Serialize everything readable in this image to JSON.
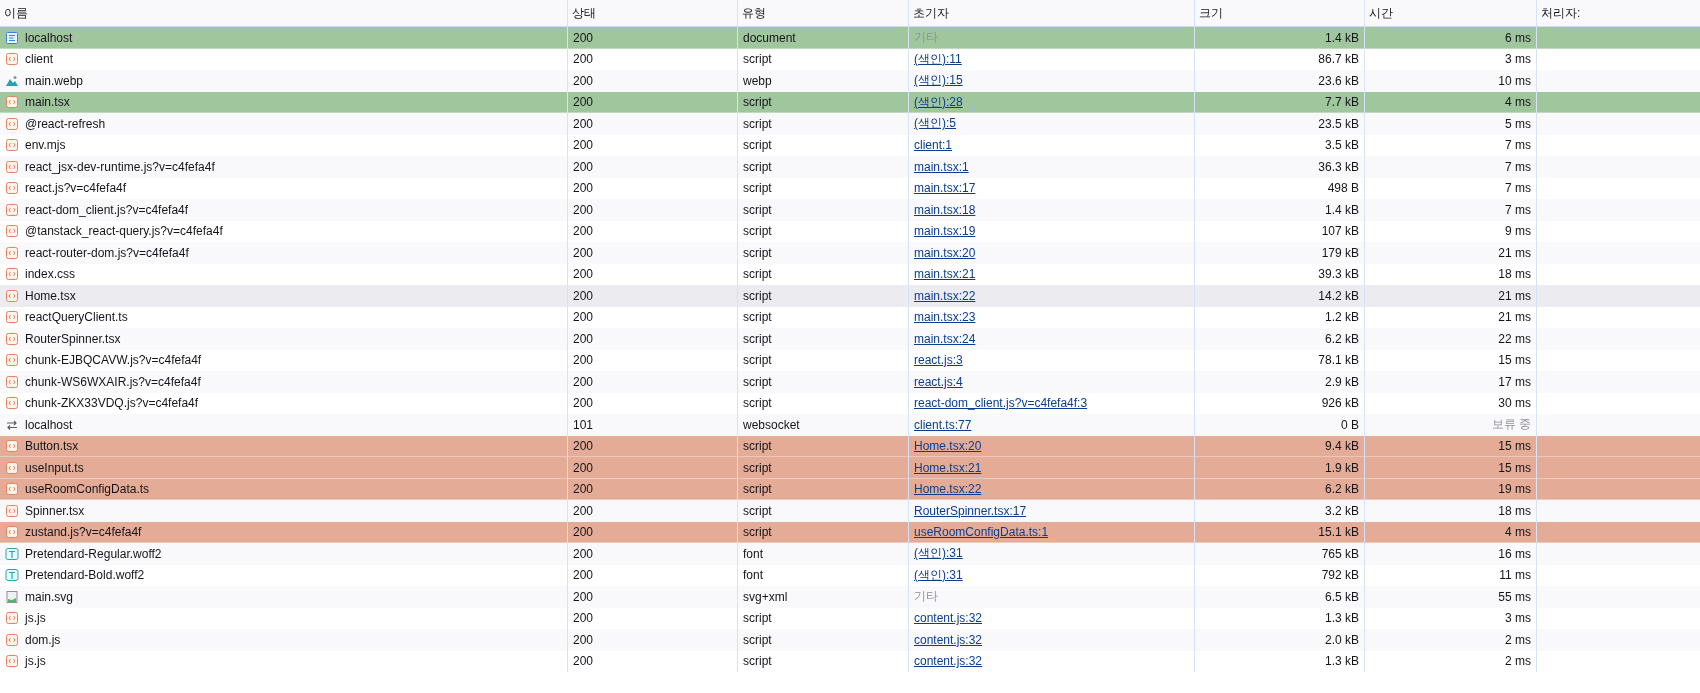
{
  "columns": [
    "이름",
    "상태",
    "유형",
    "초기자",
    "크기",
    "시간",
    "처리자:"
  ],
  "rows": [
    {
      "kind": "document",
      "name": "localhost",
      "status": "200",
      "type": "document",
      "initiator": "기타",
      "initiator_link": false,
      "size": "1.4 kB",
      "time": "6 ms",
      "pending": false,
      "initiator_highlighted": true,
      "dependent_highlighted": false,
      "hovered": false
    },
    {
      "kind": "script",
      "name": "client",
      "status": "200",
      "type": "script",
      "initiator": "(색인):11",
      "initiator_link": true,
      "size": "86.7 kB",
      "time": "3 ms",
      "pending": false,
      "initiator_highlighted": false,
      "dependent_highlighted": false,
      "hovered": false
    },
    {
      "kind": "image",
      "name": "main.webp",
      "status": "200",
      "type": "webp",
      "initiator": "(색인):15",
      "initiator_link": true,
      "size": "23.6 kB",
      "time": "10 ms",
      "pending": false,
      "initiator_highlighted": false,
      "dependent_highlighted": false,
      "hovered": false
    },
    {
      "kind": "script",
      "name": "main.tsx",
      "status": "200",
      "type": "script",
      "initiator": "(색인):28",
      "initiator_link": true,
      "size": "7.7 kB",
      "time": "4 ms",
      "pending": false,
      "initiator_highlighted": true,
      "dependent_highlighted": false,
      "hovered": false
    },
    {
      "kind": "script",
      "name": "@react-refresh",
      "status": "200",
      "type": "script",
      "initiator": "(색인):5",
      "initiator_link": true,
      "size": "23.5 kB",
      "time": "5 ms",
      "pending": false,
      "initiator_highlighted": false,
      "dependent_highlighted": false,
      "hovered": false
    },
    {
      "kind": "script",
      "name": "env.mjs",
      "status": "200",
      "type": "script",
      "initiator": "client:1",
      "initiator_link": true,
      "size": "3.5 kB",
      "time": "7 ms",
      "pending": false,
      "initiator_highlighted": false,
      "dependent_highlighted": false,
      "hovered": false
    },
    {
      "kind": "script",
      "name": "react_jsx-dev-runtime.js?v=c4fefa4f",
      "status": "200",
      "type": "script",
      "initiator": "main.tsx:1",
      "initiator_link": true,
      "size": "36.3 kB",
      "time": "7 ms",
      "pending": false,
      "initiator_highlighted": false,
      "dependent_highlighted": false,
      "hovered": false
    },
    {
      "kind": "script",
      "name": "react.js?v=c4fefa4f",
      "status": "200",
      "type": "script",
      "initiator": "main.tsx:17",
      "initiator_link": true,
      "size": "498 B",
      "time": "7 ms",
      "pending": false,
      "initiator_highlighted": false,
      "dependent_highlighted": false,
      "hovered": false
    },
    {
      "kind": "script",
      "name": "react-dom_client.js?v=c4fefa4f",
      "status": "200",
      "type": "script",
      "initiator": "main.tsx:18",
      "initiator_link": true,
      "size": "1.4 kB",
      "time": "7 ms",
      "pending": false,
      "initiator_highlighted": false,
      "dependent_highlighted": false,
      "hovered": false
    },
    {
      "kind": "script",
      "name": "@tanstack_react-query.js?v=c4fefa4f",
      "status": "200",
      "type": "script",
      "initiator": "main.tsx:19",
      "initiator_link": true,
      "size": "107 kB",
      "time": "9 ms",
      "pending": false,
      "initiator_highlighted": false,
      "dependent_highlighted": false,
      "hovered": false
    },
    {
      "kind": "script",
      "name": "react-router-dom.js?v=c4fefa4f",
      "status": "200",
      "type": "script",
      "initiator": "main.tsx:20",
      "initiator_link": true,
      "size": "179 kB",
      "time": "21 ms",
      "pending": false,
      "initiator_highlighted": false,
      "dependent_highlighted": false,
      "hovered": false
    },
    {
      "kind": "script",
      "name": "index.css",
      "status": "200",
      "type": "script",
      "initiator": "main.tsx:21",
      "initiator_link": true,
      "size": "39.3 kB",
      "time": "18 ms",
      "pending": false,
      "initiator_highlighted": false,
      "dependent_highlighted": false,
      "hovered": false
    },
    {
      "kind": "script",
      "name": "Home.tsx",
      "status": "200",
      "type": "script",
      "initiator": "main.tsx:22",
      "initiator_link": true,
      "size": "14.2 kB",
      "time": "21 ms",
      "pending": false,
      "initiator_highlighted": false,
      "dependent_highlighted": false,
      "hovered": true
    },
    {
      "kind": "script",
      "name": "reactQueryClient.ts",
      "status": "200",
      "type": "script",
      "initiator": "main.tsx:23",
      "initiator_link": true,
      "size": "1.2 kB",
      "time": "21 ms",
      "pending": false,
      "initiator_highlighted": false,
      "dependent_highlighted": false,
      "hovered": false
    },
    {
      "kind": "script",
      "name": "RouterSpinner.tsx",
      "status": "200",
      "type": "script",
      "initiator": "main.tsx:24",
      "initiator_link": true,
      "size": "6.2 kB",
      "time": "22 ms",
      "pending": false,
      "initiator_highlighted": false,
      "dependent_highlighted": false,
      "hovered": false
    },
    {
      "kind": "script",
      "name": "chunk-EJBQCAVW.js?v=c4fefa4f",
      "status": "200",
      "type": "script",
      "initiator": "react.js:3",
      "initiator_link": true,
      "size": "78.1 kB",
      "time": "15 ms",
      "pending": false,
      "initiator_highlighted": false,
      "dependent_highlighted": false,
      "hovered": false
    },
    {
      "kind": "script",
      "name": "chunk-WS6WXAIR.js?v=c4fefa4f",
      "status": "200",
      "type": "script",
      "initiator": "react.js:4",
      "initiator_link": true,
      "size": "2.9 kB",
      "time": "17 ms",
      "pending": false,
      "initiator_highlighted": false,
      "dependent_highlighted": false,
      "hovered": false
    },
    {
      "kind": "script",
      "name": "chunk-ZKX33VDQ.js?v=c4fefa4f",
      "status": "200",
      "type": "script",
      "initiator": "react-dom_client.js?v=c4fefa4f:3",
      "initiator_link": true,
      "size": "926 kB",
      "time": "30 ms",
      "pending": false,
      "initiator_highlighted": false,
      "dependent_highlighted": false,
      "hovered": false
    },
    {
      "kind": "websocket",
      "name": "localhost",
      "status": "101",
      "type": "websocket",
      "initiator": "client.ts:77",
      "initiator_link": true,
      "size": "0 B",
      "time": "보류 중",
      "pending": true,
      "initiator_highlighted": false,
      "dependent_highlighted": false,
      "hovered": false
    },
    {
      "kind": "script",
      "name": "Button.tsx",
      "status": "200",
      "type": "script",
      "initiator": "Home.tsx:20",
      "initiator_link": true,
      "size": "9.4 kB",
      "time": "15 ms",
      "pending": false,
      "initiator_highlighted": false,
      "dependent_highlighted": true,
      "hovered": false
    },
    {
      "kind": "script",
      "name": "useInput.ts",
      "status": "200",
      "type": "script",
      "initiator": "Home.tsx:21",
      "initiator_link": true,
      "size": "1.9 kB",
      "time": "15 ms",
      "pending": false,
      "initiator_highlighted": false,
      "dependent_highlighted": true,
      "hovered": false
    },
    {
      "kind": "script",
      "name": "useRoomConfigData.ts",
      "status": "200",
      "type": "script",
      "initiator": "Home.tsx:22",
      "initiator_link": true,
      "size": "6.2 kB",
      "time": "19 ms",
      "pending": false,
      "initiator_highlighted": false,
      "dependent_highlighted": true,
      "hovered": false
    },
    {
      "kind": "script",
      "name": "Spinner.tsx",
      "status": "200",
      "type": "script",
      "initiator": "RouterSpinner.tsx:17",
      "initiator_link": true,
      "size": "3.2 kB",
      "time": "18 ms",
      "pending": false,
      "initiator_highlighted": false,
      "dependent_highlighted": false,
      "hovered": false
    },
    {
      "kind": "script",
      "name": "zustand.js?v=c4fefa4f",
      "status": "200",
      "type": "script",
      "initiator": "useRoomConfigData.ts:1",
      "initiator_link": true,
      "size": "15.1 kB",
      "time": "4 ms",
      "pending": false,
      "initiator_highlighted": false,
      "dependent_highlighted": true,
      "hovered": false
    },
    {
      "kind": "font",
      "name": "Pretendard-Regular.woff2",
      "status": "200",
      "type": "font",
      "initiator": "(색인):31",
      "initiator_link": true,
      "size": "765 kB",
      "time": "16 ms",
      "pending": false,
      "initiator_highlighted": false,
      "dependent_highlighted": false,
      "hovered": false
    },
    {
      "kind": "font",
      "name": "Pretendard-Bold.woff2",
      "status": "200",
      "type": "font",
      "initiator": "(색인):31",
      "initiator_link": true,
      "size": "792 kB",
      "time": "11 ms",
      "pending": false,
      "initiator_highlighted": false,
      "dependent_highlighted": false,
      "hovered": false
    },
    {
      "kind": "svg",
      "name": "main.svg",
      "status": "200",
      "type": "svg+xml",
      "initiator": "기타",
      "initiator_link": false,
      "size": "6.5 kB",
      "time": "55 ms",
      "pending": false,
      "initiator_highlighted": false,
      "dependent_highlighted": false,
      "hovered": false
    },
    {
      "kind": "script",
      "name": "js.js",
      "status": "200",
      "type": "script",
      "initiator": "content.js:32",
      "initiator_link": true,
      "size": "1.3 kB",
      "time": "3 ms",
      "pending": false,
      "initiator_highlighted": false,
      "dependent_highlighted": false,
      "hovered": false
    },
    {
      "kind": "script",
      "name": "dom.js",
      "status": "200",
      "type": "script",
      "initiator": "content.js:32",
      "initiator_link": true,
      "size": "2.0 kB",
      "time": "2 ms",
      "pending": false,
      "initiator_highlighted": false,
      "dependent_highlighted": false,
      "hovered": false
    },
    {
      "kind": "script",
      "name": "js.js",
      "status": "200",
      "type": "script",
      "initiator": "content.js:32",
      "initiator_link": true,
      "size": "1.3 kB",
      "time": "2 ms",
      "pending": false,
      "initiator_highlighted": false,
      "dependent_highlighted": false,
      "hovered": false
    }
  ]
}
